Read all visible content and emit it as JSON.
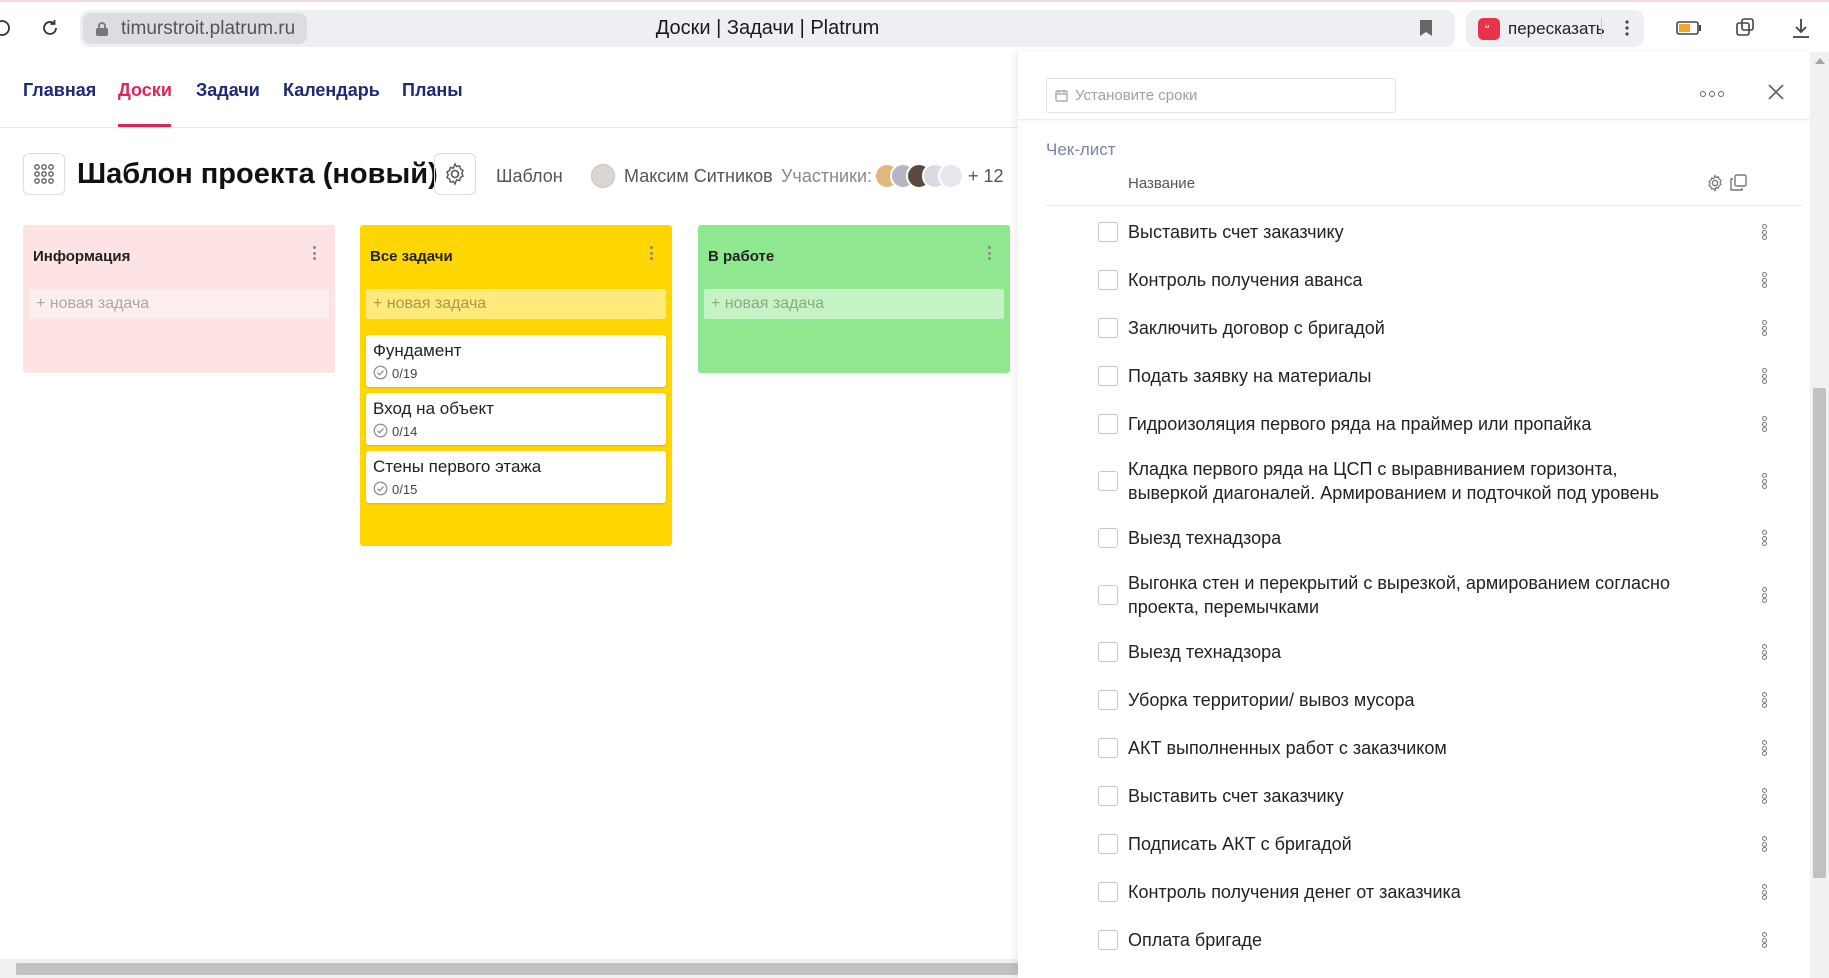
{
  "browser": {
    "url": "timurstroit.platrum.ru",
    "page_title": "Доски | Задачи | Platrum",
    "retell_label": "пересказать"
  },
  "nav": {
    "items": [
      {
        "label": "Главная"
      },
      {
        "label": "Доски"
      },
      {
        "label": "Задачи"
      },
      {
        "label": "Календарь"
      },
      {
        "label": "Планы"
      }
    ],
    "active": "Доски",
    "accent_color": "#e0245e",
    "link_color": "#1e2a78"
  },
  "board": {
    "title": "Шаблон проекта (новый)",
    "template_label": "Шаблон",
    "owner": "Максим Ситников",
    "participants_label": "Участники:",
    "participants_more": "+ 12"
  },
  "columns": [
    {
      "title": "Информация",
      "color": "#fde3e3",
      "new_task": "+ новая задача",
      "tasks": []
    },
    {
      "title": "Все задачи",
      "color": "#ffd600",
      "new_task": "+ новая задача",
      "tasks": [
        {
          "title": "Фундамент",
          "progress": "0/19"
        },
        {
          "title": "Вход на объект",
          "progress": "0/14"
        },
        {
          "title": "Стены первого этажа",
          "progress": "0/15"
        }
      ]
    },
    {
      "title": "В работе",
      "color": "#8fe88f",
      "new_task": "+ новая задача",
      "tasks": []
    }
  ],
  "panel": {
    "deadline_placeholder": "Установите сроки",
    "checklist_title": "Чек-лист",
    "column_name": "Название",
    "items": [
      "Выставить счет заказчику",
      "Контроль получения аванса",
      "Заключить договор с бригадой",
      "Подать заявку на материалы",
      "Гидроизоляция первого ряда на праймер или пропайка",
      "Кладка первого ряда на ЦСП с выравниванием горизонта, выверкой диагоналей. Армированием и подточкой под уровень",
      "Выезд технадзора",
      "Выгонка стен и перекрытий с вырезкой, армированием согласно проекта, перемычками",
      "Выезд технадзора",
      "Уборка территории/ вывоз мусора",
      "АКТ выполненных работ с заказчиком",
      "Выставить счет заказчику",
      "Подписать АКТ с бригадой",
      "Контроль получения денег от заказчика",
      "Оплата бригаде"
    ]
  }
}
